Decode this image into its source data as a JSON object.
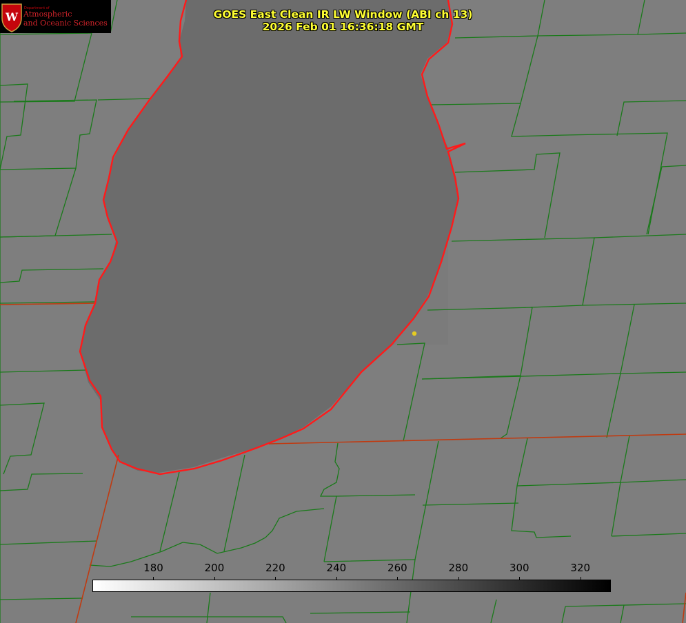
{
  "title": {
    "line1": "GOES East Clean IR LW Window (ABI ch 13)",
    "line2": "2026 Feb 01 16:36:18 GMT"
  },
  "logo": {
    "department": "Department of",
    "line1": "Atmospheric",
    "line2": "and Oceanic Sciences",
    "emblem_letter": "W",
    "emblem_color": "#c5050c"
  },
  "colorbar": {
    "min": 160,
    "max": 330,
    "labels": [
      "180",
      "200",
      "220",
      "240",
      "260",
      "280",
      "300",
      "320"
    ],
    "warm_color": "#000000",
    "cold_color": "#ffffff"
  },
  "colors": {
    "county_lines": "#1a7a1a",
    "state_lines": "#d42a00",
    "coastline": "#ff1a1a",
    "marker": "#e6cc22",
    "title_text": "#ffff33"
  }
}
